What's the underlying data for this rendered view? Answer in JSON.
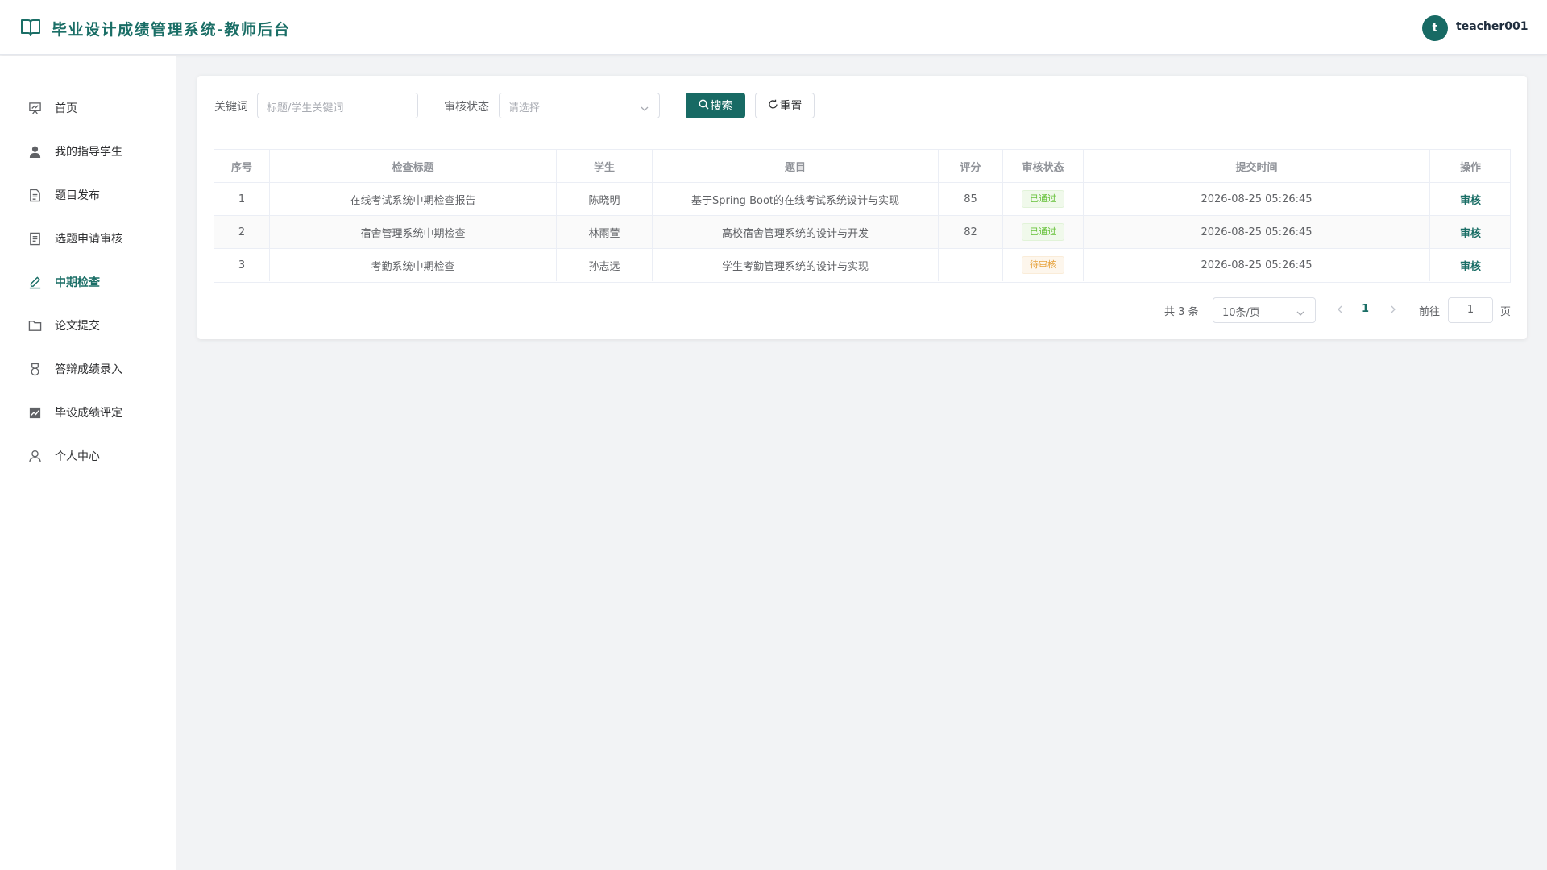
{
  "header": {
    "title": "毕业设计成绩管理系统-教师后台",
    "avatar_letter": "t",
    "username": "teacher001"
  },
  "colors": {
    "brand": "#186a64",
    "success": "#67c23a",
    "warning": "#e6a23c"
  },
  "sidebar": {
    "items": [
      {
        "label": "首页",
        "icon": "presentation-board-icon",
        "active": false
      },
      {
        "label": "我的指导学生",
        "icon": "user-filled-icon",
        "active": false
      },
      {
        "label": "题目发布",
        "icon": "document-icon",
        "active": false
      },
      {
        "label": "选题申请审核",
        "icon": "document-checklist-icon",
        "active": false
      },
      {
        "label": "中期检查",
        "icon": "pen-edit-icon",
        "active": true
      },
      {
        "label": "论文提交",
        "icon": "folder-icon",
        "active": false
      },
      {
        "label": "答辩成绩录入",
        "icon": "medal-icon",
        "active": false
      },
      {
        "label": "毕设成绩评定",
        "icon": "trend-chart-icon",
        "active": false
      },
      {
        "label": "个人中心",
        "icon": "user-icon",
        "active": false
      }
    ]
  },
  "filters": {
    "keyword_label": "关键词",
    "keyword_placeholder": "标题/学生关键词",
    "status_label": "审核状态",
    "status_placeholder": "请选择",
    "search_button": "搜索",
    "reset_button": "重置"
  },
  "table": {
    "headers": [
      "序号",
      "检查标题",
      "学生",
      "题目",
      "评分",
      "审核状态",
      "提交时间",
      "操作"
    ],
    "rows": [
      {
        "index": "1",
        "title": "在线考试系统中期检查报告",
        "student": "陈晓明",
        "topic": "基于Spring Boot的在线考试系统设计与实现",
        "score": "85",
        "status": "已通过",
        "status_type": "ok",
        "time": "2026-08-25 05:26:45",
        "action": "审核"
      },
      {
        "index": "2",
        "title": "宿舍管理系统中期检查",
        "student": "林雨萱",
        "topic": "高校宿舍管理系统的设计与开发",
        "score": "82",
        "status": "已通过",
        "status_type": "ok",
        "time": "2026-08-25 05:26:45",
        "action": "审核"
      },
      {
        "index": "3",
        "title": "考勤系统中期检查",
        "student": "孙志远",
        "topic": "学生考勤管理系统的设计与实现",
        "score": "",
        "status": "待审核",
        "status_type": "wait",
        "time": "2026-08-25 05:26:45",
        "action": "审核"
      }
    ]
  },
  "pagination": {
    "total": "共 3 条",
    "page_size": "10条/页",
    "current_page": "1",
    "goto_label": "前往",
    "goto_value": "1",
    "page_suffix": "页"
  }
}
